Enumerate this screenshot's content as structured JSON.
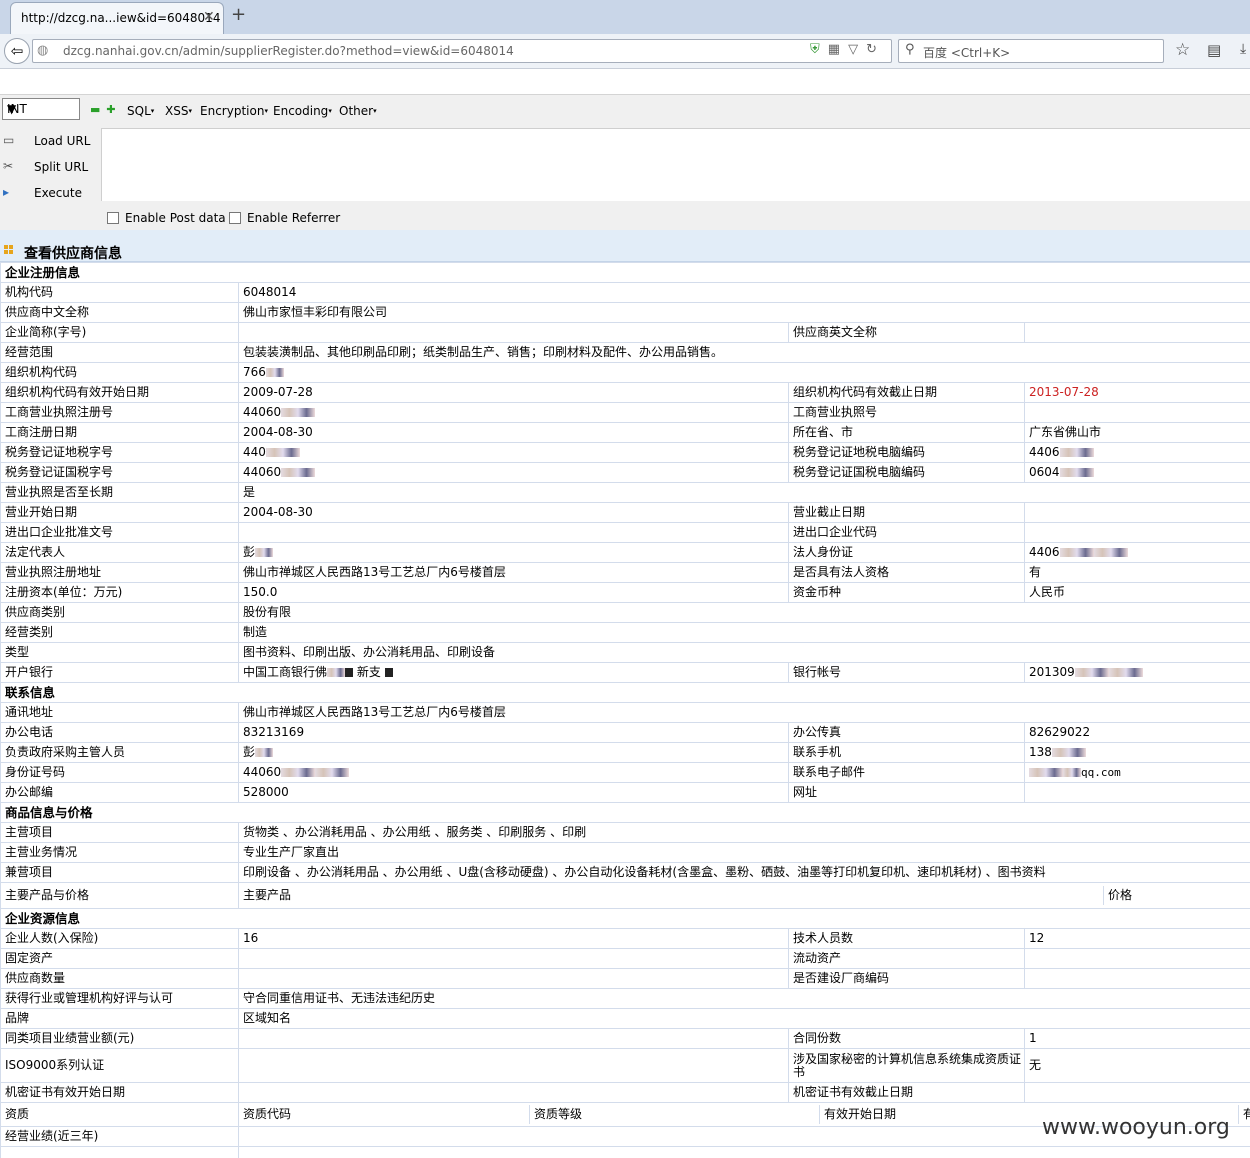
{
  "browser": {
    "tab_title": "http://dzcg.na...iew&id=6048014",
    "url": "dzcg.nanhai.gov.cn/admin/supplierRegister.do?method=view&id=6048014",
    "search_placeholder": "百度 <Ctrl+K>"
  },
  "hackbar": {
    "select_value": "INT",
    "menus": [
      "SQL",
      "XSS",
      "Encryption",
      "Encoding",
      "Other"
    ],
    "buttons": [
      "Load URL",
      "Split URL",
      "Execute"
    ],
    "checkboxes": [
      "Enable Post data",
      "Enable Referrer"
    ]
  },
  "page": {
    "title": "查看供应商信息",
    "sections": {
      "reg": "企业注册信息",
      "contact": "联系信息",
      "goods": "商品信息与价格",
      "resource": "企业资源信息"
    },
    "rows": {
      "r1": {
        "l": "机构代码",
        "v": "6048014"
      },
      "r2": {
        "l": "供应商中文全称",
        "v": "佛山市家恒丰彩印有限公司"
      },
      "r3": {
        "l": "企业简称(字号)",
        "v": "",
        "l2": "供应商英文全称",
        "v2": ""
      },
      "r4": {
        "l": "经营范围",
        "v": "包装装潢制品、其他印刷品印刷；纸类制品生产、销售；印刷材料及配件、办公用品销售。"
      },
      "r5": {
        "l": "组织机构代码",
        "v": "766"
      },
      "r6": {
        "l": "组织机构代码有效开始日期",
        "v": "2009-07-28",
        "l2": "组织机构代码有效截止日期",
        "v2": "2013-07-28"
      },
      "r7": {
        "l": "工商营业执照注册号",
        "v": "44060",
        "l2": "工商营业执照号",
        "v2": ""
      },
      "r8": {
        "l": "工商注册日期",
        "v": "2004-08-30",
        "l2": "所在省、市",
        "v2": "广东省佛山市"
      },
      "r9": {
        "l": "税务登记证地税字号",
        "v": "440",
        "l2": "税务登记证地税电脑编码",
        "v2": "4406"
      },
      "r10": {
        "l": "税务登记证国税字号",
        "v": "44060",
        "l2": "税务登记证国税电脑编码",
        "v2": "0604"
      },
      "r11": {
        "l": "营业执照是否至长期",
        "v": "是"
      },
      "r12": {
        "l": "营业开始日期",
        "v": "2004-08-30",
        "l2": "营业截止日期",
        "v2": ""
      },
      "r13": {
        "l": "进出口企业批准文号",
        "v": "",
        "l2": "进出口企业代码",
        "v2": ""
      },
      "r14": {
        "l": "法定代表人",
        "v": "彭",
        "l2": "法人身份证",
        "v2": "4406"
      },
      "r15": {
        "l": "营业执照注册地址",
        "v": "佛山市禅城区人民西路13号工艺总厂内6号楼首层",
        "l2": "是否具有法人资格",
        "v2": "有"
      },
      "r16": {
        "l": "注册资本(单位：万元)",
        "v": "150.0",
        "l2": "资金币种",
        "v2": "人民币"
      },
      "r17": {
        "l": "供应商类别",
        "v": "股份有限"
      },
      "r18": {
        "l": "经营类别",
        "v": "制造"
      },
      "r19": {
        "l": "类型",
        "v": "图书资料、印刷出版、办公消耗用品、印刷设备"
      },
      "r20": {
        "l": "开户银行",
        "v": "中国工商银行佛",
        "v_tail": "新支",
        "l2": "银行帐号",
        "v2": "201309"
      },
      "c1": {
        "l": "通讯地址",
        "v": "佛山市禅城区人民西路13号工艺总厂内6号楼首层"
      },
      "c2": {
        "l": "办公电话",
        "v": "83213169",
        "l2": "办公传真",
        "v2": "82629022"
      },
      "c3": {
        "l": "负责政府采购主管人员",
        "v": "彭",
        "l2": "联系手机",
        "v2": "138"
      },
      "c4": {
        "l": "身份证号码",
        "v": "44060",
        "l2": "联系电子邮件",
        "v2": "qq.com"
      },
      "c5": {
        "l": "办公邮编",
        "v": "528000",
        "l2": "网址",
        "v2": ""
      },
      "g1": {
        "l": "主营项目",
        "v": "货物类 、办公消耗用品 、办公用纸 、服务类 、印刷服务 、印刷"
      },
      "g2": {
        "l": "主营业务情况",
        "v": "专业生产厂家直出"
      },
      "g3": {
        "l": "兼营项目",
        "v": "印刷设备 、办公消耗用品 、办公用纸 、U盘(含移动硬盘) 、办公自动化设备耗材(含墨盒、墨粉、硒鼓、油墨等打印机复印机、速印机耗材) 、图书资料"
      },
      "g4": {
        "l": "主要产品与价格",
        "h1": "主要产品",
        "h2": "价格"
      },
      "e1": {
        "l": "企业人数(入保险)",
        "v": "16",
        "l2": "技术人员数",
        "v2": "12"
      },
      "e2": {
        "l": "固定资产",
        "v": "",
        "l2": "流动资产",
        "v2": ""
      },
      "e3": {
        "l": "供应商数量",
        "v": "",
        "l2": "是否建设厂商编码",
        "v2": ""
      },
      "e4": {
        "l": "获得行业或管理机构好评与认可",
        "v": "守合同重信用证书、无违法违纪历史"
      },
      "e5": {
        "l": "品牌",
        "v": "区域知名"
      },
      "e6": {
        "l": "同类项目业绩营业额(元)",
        "v": "",
        "l2": "合同份数",
        "v2": "1"
      },
      "e7": {
        "l": "ISO9000系列认证",
        "v": "",
        "l2": "涉及国家秘密的计算机信息系统集成资质证书",
        "v2": "无"
      },
      "e8": {
        "l": "机密证书有效开始日期",
        "v": "",
        "l2": "机密证书有效截止日期",
        "v2": ""
      },
      "e9": {
        "l": "资质",
        "h1": "资质代码",
        "h2": "资质等级",
        "h3": "有效开始日期",
        "h4": "有"
      },
      "e10": {
        "l": "经营业绩(近三年)",
        "v": ""
      }
    }
  },
  "watermark": "www.wooyun.org"
}
